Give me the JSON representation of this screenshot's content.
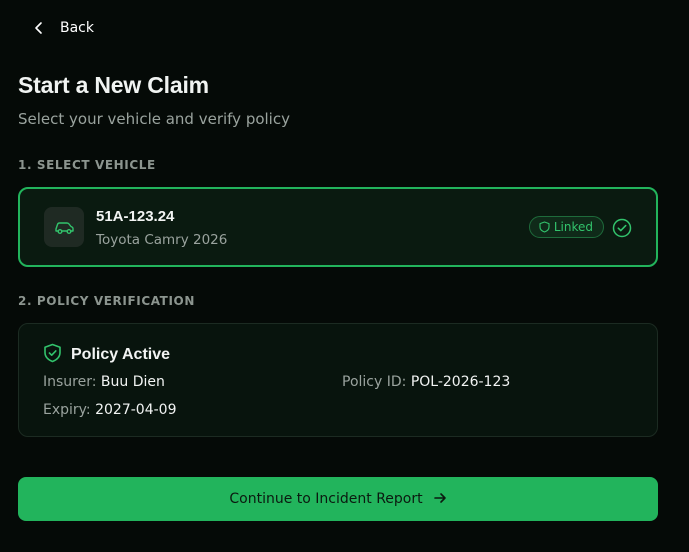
{
  "nav": {
    "back_label": "Back"
  },
  "header": {
    "title": "Start a New Claim",
    "subtitle": "Select your vehicle and verify policy"
  },
  "sections": {
    "select_vehicle": "1. SELECT VEHICLE",
    "policy_verification": "2. POLICY VERIFICATION"
  },
  "vehicle": {
    "plate": "51A-123.24",
    "model": "Toyota Camry 2026",
    "status_badge": "Linked",
    "icon": "car-icon"
  },
  "policy": {
    "status": "Policy Active",
    "insurer_label": "Insurer:",
    "insurer": "Buu Dien",
    "policy_id_label": "Policy ID:",
    "policy_id": "POL-2026-123",
    "expiry_label": "Expiry:",
    "expiry": "2027-04-09"
  },
  "cta": {
    "label": "Continue to Incident Report"
  },
  "colors": {
    "background": "#050a07",
    "accent": "#22b45c",
    "card": "#0a1a10",
    "muted_text": "#9aa39e"
  }
}
